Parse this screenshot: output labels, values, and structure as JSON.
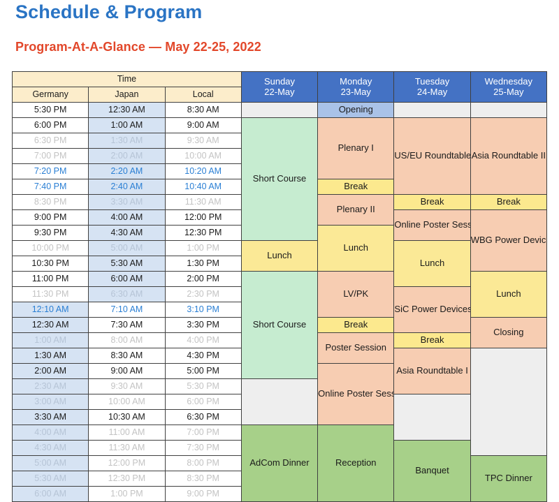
{
  "page": {
    "title": "Schedule & Program",
    "subtitle": "Program-At-A-Glance — May 22-25, 2022"
  },
  "colors": {
    "title": "#2a74c4",
    "subtitle": "#e2472a",
    "day_header": "#4472c4",
    "time_header": "#fcedcb",
    "short_course": "#c6ecd0",
    "session": "#f7cdb2",
    "break": "#fce98e",
    "lunch": "#fbe996",
    "social": "#a7d089",
    "opening": "#a9c2e8",
    "empty": "#eeeeee",
    "highlight_time": "#2a7fd4",
    "dim_time": "#c3c3c3",
    "shaded_column": "#d6e3f3"
  },
  "table": {
    "time_group_label": "Time",
    "time_columns": [
      "Germany",
      "Japan",
      "Local"
    ],
    "day_columns": [
      {
        "day": "Sunday",
        "date": "22-May"
      },
      {
        "day": "Monday",
        "date": "23-May"
      },
      {
        "day": "Tuesday",
        "date": "24-May"
      },
      {
        "day": "Wednesday",
        "date": "25-May"
      }
    ],
    "rows": [
      {
        "germany": "5:30 PM",
        "japan": "12:30 AM",
        "local": "8:30 AM",
        "style": "on"
      },
      {
        "germany": "6:00 PM",
        "japan": "1:00 AM",
        "local": "9:00 AM",
        "style": "on"
      },
      {
        "germany": "6:30 PM",
        "japan": "1:30 AM",
        "local": "9:30 AM",
        "style": "dim"
      },
      {
        "germany": "7:00 PM",
        "japan": "2:00 AM",
        "local": "10:00 AM",
        "style": "dim"
      },
      {
        "germany": "7:20 PM",
        "japan": "2:20 AM",
        "local": "10:20 AM",
        "style": "blue"
      },
      {
        "germany": "7:40 PM",
        "japan": "2:40 AM",
        "local": "10:40 AM",
        "style": "blue"
      },
      {
        "germany": "8:30 PM",
        "japan": "3:30 AM",
        "local": "11:30 AM",
        "style": "dim"
      },
      {
        "germany": "9:00 PM",
        "japan": "4:00 AM",
        "local": "12:00 PM",
        "style": "on"
      },
      {
        "germany": "9:30 PM",
        "japan": "4:30 AM",
        "local": "12:30 PM",
        "style": "on"
      },
      {
        "germany": "10:00 PM",
        "japan": "5:00 AM",
        "local": "1:00 PM",
        "style": "dim"
      },
      {
        "germany": "10:30 PM",
        "japan": "5:30 AM",
        "local": "1:30 PM",
        "style": "on"
      },
      {
        "germany": "11:00 PM",
        "japan": "6:00 AM",
        "local": "2:00 PM",
        "style": "on"
      },
      {
        "germany": "11:30 PM",
        "japan": "6:30 AM",
        "local": "2:30 PM",
        "style": "dim"
      },
      {
        "germany": "12:10 AM",
        "japan": "7:10 AM",
        "local": "3:10 PM",
        "style": "blue"
      },
      {
        "germany": "12:30 AM",
        "japan": "7:30 AM",
        "local": "3:30 PM",
        "style": "on"
      },
      {
        "germany": "1:00 AM",
        "japan": "8:00 AM",
        "local": "4:00 PM",
        "style": "dim"
      },
      {
        "germany": "1:30 AM",
        "japan": "8:30 AM",
        "local": "4:30 PM",
        "style": "on"
      },
      {
        "germany": "2:00 AM",
        "japan": "9:00 AM",
        "local": "5:00 PM",
        "style": "on"
      },
      {
        "germany": "2:30 AM",
        "japan": "9:30 AM",
        "local": "5:30 PM",
        "style": "dim"
      },
      {
        "germany": "3:00 AM",
        "japan": "10:00 AM",
        "local": "6:00 PM",
        "style": "dim"
      },
      {
        "germany": "3:30 AM",
        "japan": "10:30 AM",
        "local": "6:30 PM",
        "style": "on"
      },
      {
        "germany": "4:00 AM",
        "japan": "11:00 AM",
        "local": "7:00 PM",
        "style": "dim"
      },
      {
        "germany": "4:30 AM",
        "japan": "11:30 AM",
        "local": "7:30 PM",
        "style": "dim"
      },
      {
        "germany": "5:00 AM",
        "japan": "12:00 PM",
        "local": "8:00 PM",
        "style": "dim"
      },
      {
        "germany": "5:30 AM",
        "japan": "12:30 PM",
        "local": "8:30 PM",
        "style": "dim"
      },
      {
        "germany": "6:00 AM",
        "japan": "1:00 PM",
        "local": "9:00 PM",
        "style": "dim"
      }
    ],
    "events": {
      "sunday": [
        {
          "label": "",
          "kind": "empty",
          "span": 1
        },
        {
          "label": "Short Course",
          "kind": "short_course",
          "span": 8
        },
        {
          "label": "Lunch",
          "kind": "lunch",
          "span": 2
        },
        {
          "label": "Short Course",
          "kind": "short_course",
          "span": 7
        },
        {
          "label": "",
          "kind": "empty",
          "span": 3
        },
        {
          "label": "AdCom Dinner",
          "kind": "social",
          "span": 5
        }
      ],
      "monday": [
        {
          "label": "Opening",
          "kind": "opening",
          "span": 1
        },
        {
          "label": "Plenary I",
          "kind": "session",
          "span": 4
        },
        {
          "label": "Break",
          "kind": "break",
          "span": 1
        },
        {
          "label": "Plenary II",
          "kind": "session",
          "span": 2
        },
        {
          "label": "Lunch",
          "kind": "lunch",
          "span": 3
        },
        {
          "label": "LV/PK",
          "kind": "session",
          "span": 3
        },
        {
          "label": "Break",
          "kind": "break",
          "span": 1
        },
        {
          "label": "Poster Session",
          "kind": "session",
          "span": 2
        },
        {
          "label": "Online Poster Session I",
          "kind": "session",
          "span": 4
        },
        {
          "label": "Reception",
          "kind": "social",
          "span": 5
        }
      ],
      "tuesday": [
        {
          "label": "",
          "kind": "empty",
          "span": 1
        },
        {
          "label": "US/EU Roundtable",
          "kind": "session",
          "span": 5
        },
        {
          "label": "Break",
          "kind": "break",
          "span": 1
        },
        {
          "label": "Online Poster Session II",
          "kind": "session",
          "span": 2
        },
        {
          "label": "Lunch",
          "kind": "lunch",
          "span": 3
        },
        {
          "label": "SiC Power Devices",
          "kind": "session",
          "span": 3
        },
        {
          "label": "Break",
          "kind": "break",
          "span": 1
        },
        {
          "label": "Asia Roundtable I",
          "kind": "session",
          "span": 3
        },
        {
          "label": "",
          "kind": "empty",
          "span": 3
        },
        {
          "label": "Banquet",
          "kind": "social",
          "span": 5
        }
      ],
      "wednesday": [
        {
          "label": "",
          "kind": "empty",
          "span": 1
        },
        {
          "label": "Asia Roundtable II",
          "kind": "session",
          "span": 5
        },
        {
          "label": "Break",
          "kind": "break",
          "span": 1
        },
        {
          "label": "WBG Power Devices",
          "kind": "session",
          "span": 4
        },
        {
          "label": "Lunch",
          "kind": "lunch",
          "span": 3
        },
        {
          "label": "Closing",
          "kind": "session",
          "span": 2
        },
        {
          "label": "",
          "kind": "empty",
          "span": 7
        },
        {
          "label": "TPC Dinner",
          "kind": "social",
          "span": 5
        }
      ]
    },
    "shaded_time_column": {
      "upper_rows": "japan",
      "lower_rows": "germany",
      "switch_at_row_index": 13
    }
  }
}
